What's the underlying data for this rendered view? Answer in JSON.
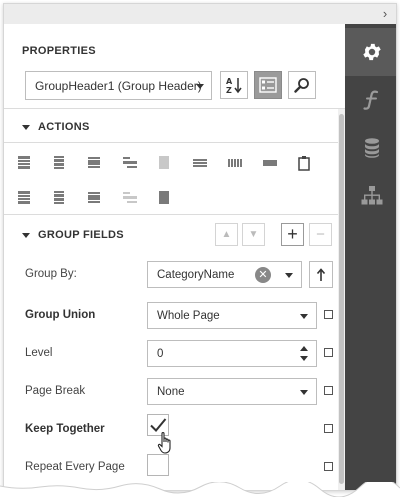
{
  "panel": {
    "title": "PROPERTIES",
    "selected_component": "GroupHeader1 (Group Header)",
    "right_tabs": [
      {
        "name": "properties",
        "icon": "gear-icon"
      },
      {
        "name": "expressions",
        "icon": "function-icon"
      },
      {
        "name": "field-list",
        "icon": "database-icon"
      },
      {
        "name": "report-explorer",
        "icon": "hierarchy-icon"
      }
    ],
    "toolbar": {
      "sort_icon": "sort-az-icon",
      "categories_icon": "categories-icon",
      "search_icon": "search-icon"
    }
  },
  "sections": {
    "actions": {
      "title": "ACTIONS",
      "row1": [
        "band-icon",
        "band-icon",
        "band-icon",
        "band-icon",
        "band-icon",
        "band-icon",
        "band-icon",
        "band-icon",
        "clipboard-icon"
      ],
      "row2": [
        "band-icon",
        "band-icon",
        "band-icon",
        "band-icon",
        "band-icon"
      ]
    },
    "group_fields": {
      "title": "GROUP FIELDS",
      "up": "▲",
      "down": "▼",
      "add": "+",
      "remove": "−"
    }
  },
  "properties": {
    "group_by": {
      "label": "Group By:",
      "value": "CategoryName"
    },
    "group_union": {
      "label": "Group Union",
      "value": "Whole Page"
    },
    "level": {
      "label": "Level",
      "value": "0"
    },
    "page_break": {
      "label": "Page Break",
      "value": "None"
    },
    "keep_together": {
      "label": "Keep Together",
      "checked": true
    },
    "repeat_every_page": {
      "label": "Repeat Every Page",
      "checked": false
    }
  }
}
